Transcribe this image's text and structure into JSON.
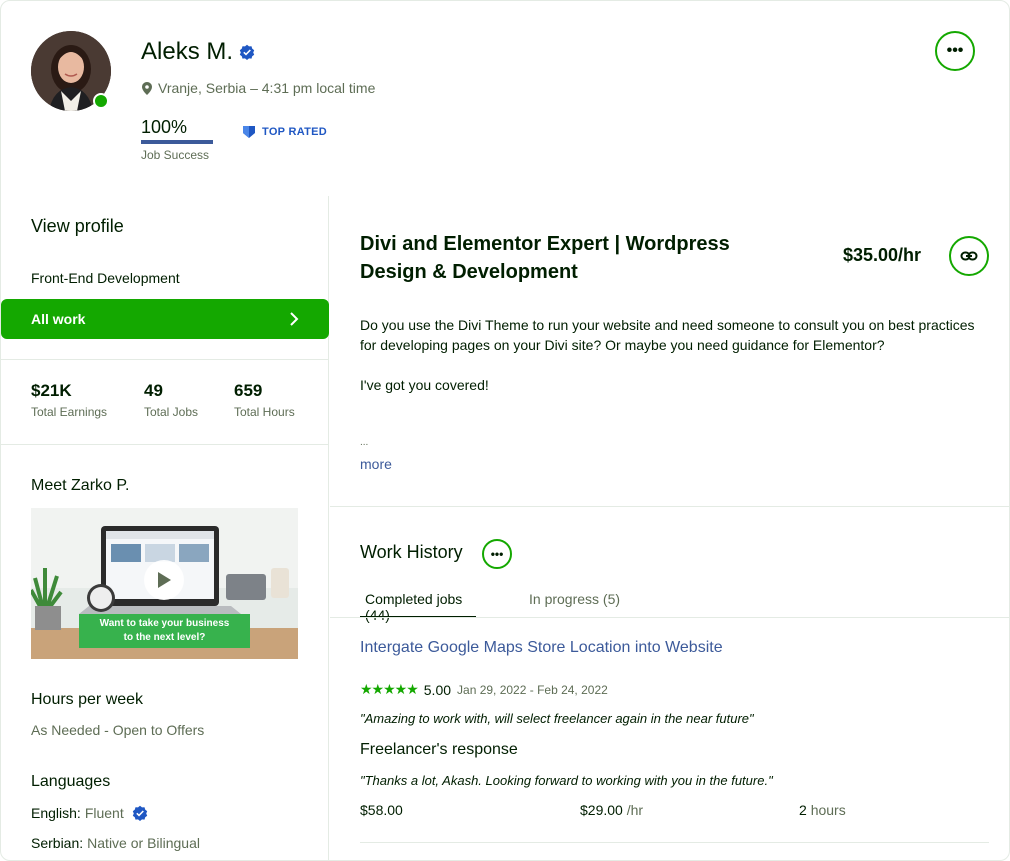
{
  "profile": {
    "name": "Aleks M.",
    "location": "Vranje, Serbia – 4:31 pm local time",
    "job_success_value": "100%",
    "job_success_label": "Job Success",
    "badge": "TOP RATED",
    "online": true
  },
  "sidebar": {
    "view_profile": "View profile",
    "category": "Front-End Development",
    "all_work": "All work",
    "stats": [
      {
        "value": "$21K",
        "label": "Total Earnings"
      },
      {
        "value": "49",
        "label": "Total Jobs"
      },
      {
        "value": "659",
        "label": "Total Hours"
      }
    ],
    "meet": "Meet Zarko P.",
    "video_caption_line1": "Want to take your business",
    "video_caption_line2": "to the next level?",
    "hours_title": "Hours per week",
    "hours_value": "As Needed - Open to Offers",
    "languages_title": "Languages",
    "languages": [
      {
        "name": "English:",
        "level": "Fluent"
      },
      {
        "name": "Serbian:",
        "level": "Native or Bilingual"
      }
    ]
  },
  "main": {
    "title": "Divi and Elementor Expert | Wordpress Design & Development",
    "rate": "$35.00/hr",
    "description_1": "Do you use the Divi Theme to run your website and need someone to consult you on best practices for developing pages on your Divi site? Or maybe you need guidance for Elementor?",
    "description_2": "I've got you covered!",
    "ellipsis": "...",
    "more": "more"
  },
  "work_history": {
    "title": "Work History",
    "tabs": [
      {
        "label": "Completed jobs (44)",
        "active": true
      },
      {
        "label": "In progress (5)",
        "active": false
      }
    ],
    "job": {
      "title": "Intergate Google Maps Store Location into Website",
      "stars": "★★★★★",
      "rating": "5.00",
      "dates": "Jan 29, 2022 - Feb 24, 2022",
      "feedback": "\"Amazing to work with, will select freelancer again in the near future\"",
      "response_title": "Freelancer's response",
      "response": "\"Thanks a lot, Akash. Looking forward to working with you in the future.\"",
      "earned": "$58.00",
      "hourly_value": "$29.00",
      "hourly_unit": "/hr",
      "hours_value": "2",
      "hours_unit": "hours"
    }
  },
  "colors": {
    "brand_green": "#14a800",
    "link_blue": "#3c5a9a",
    "verified_blue": "#1f57c3"
  },
  "icons": [
    "verified-icon",
    "location-pin-icon",
    "top-rated-icon",
    "ellipsis-icon",
    "chevron-right-icon",
    "play-icon",
    "link-icon"
  ]
}
